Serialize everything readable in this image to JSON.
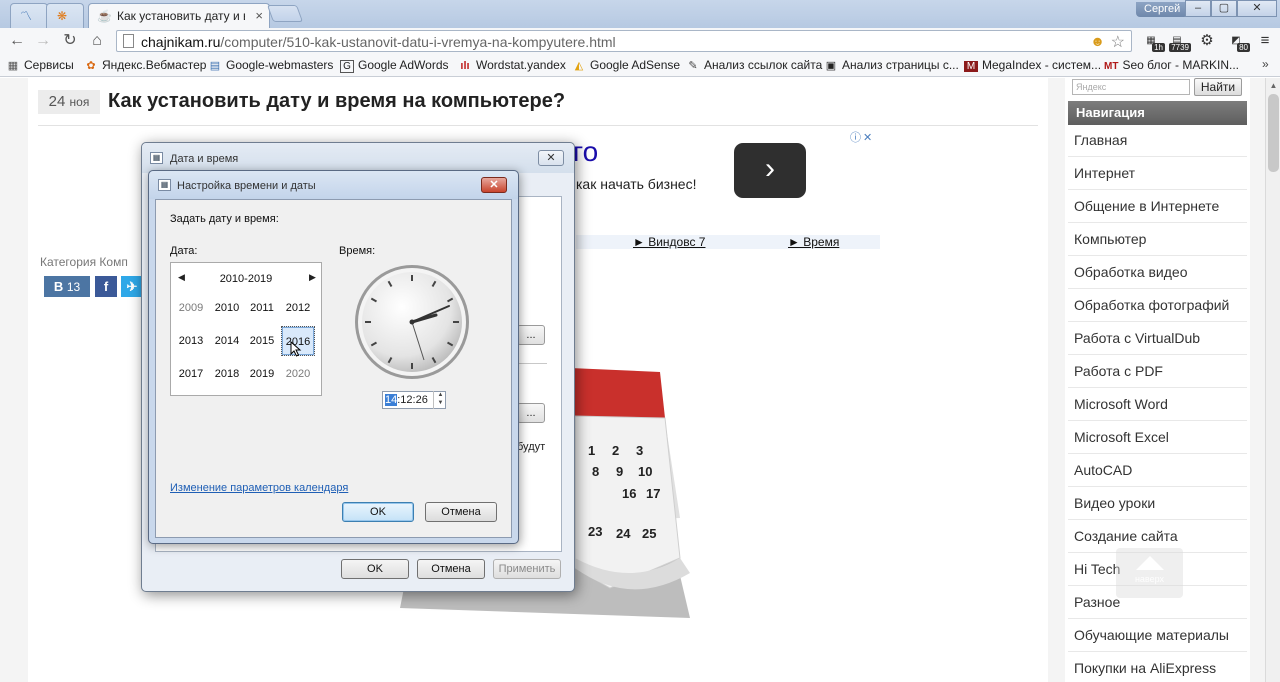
{
  "browser": {
    "tabs": [
      {
        "title": "",
        "icon": "analytics-icon"
      },
      {
        "title": "",
        "icon": "yandex-metrika-icon"
      },
      {
        "title": "Как установить дату и вр",
        "icon": "page-favicon"
      }
    ],
    "user": "Сергей",
    "window_controls": [
      "–",
      "▢",
      "✕"
    ],
    "url_domain": "chajnikam.ru",
    "url_path": "/computer/510-kak-ustanovit-datu-i-vremya-na-kompyutere.html",
    "extensions": [
      {
        "icon": "ext-1h-icon",
        "label": "",
        "badge": "1h"
      },
      {
        "icon": "ext-counter-icon",
        "label": "",
        "badge": "7739"
      },
      {
        "icon": "gear-icon",
        "label": "⚙",
        "badge": ""
      },
      {
        "icon": "ext-80-icon",
        "label": "",
        "badge": "80"
      },
      {
        "icon": "menu-icon",
        "label": "≡",
        "badge": ""
      }
    ],
    "bookmarks": [
      {
        "label": "Сервисы",
        "icon": "apps-grid-icon",
        "glyph": "▦"
      },
      {
        "label": "Яндекс.Вебмастер",
        "icon": "yandex-webmaster-icon",
        "glyph": "✿"
      },
      {
        "label": "Google-webmasters",
        "icon": "google-webmasters-icon",
        "glyph": "▤"
      },
      {
        "label": "Google AdWords",
        "icon": "adwords-icon",
        "glyph": "G"
      },
      {
        "label": "Wordstat.yandex",
        "icon": "wordstat-icon",
        "glyph": "ılı"
      },
      {
        "label": "Google AdSense",
        "icon": "adsense-icon",
        "glyph": "◭"
      },
      {
        "label": "Анализ ссылок сайта",
        "icon": "link-analysis-icon",
        "glyph": "✎"
      },
      {
        "label": "Анализ страницы с...",
        "icon": "page-analysis-icon",
        "glyph": "▣"
      },
      {
        "label": "MegaIndex - систем...",
        "icon": "megaindex-icon",
        "glyph": "M"
      },
      {
        "label": "Seo блог - MARKIN...",
        "icon": "seo-blog-icon",
        "glyph": "MT"
      }
    ],
    "bookmarks_more": "»"
  },
  "article": {
    "date_day": "24",
    "date_month": "ноя",
    "title": "Как установить дату и время на компьютере?",
    "category_label": "Категория Комп",
    "ad_big": "го",
    "ad_sub": "как начать бизнес!",
    "ad_links": [
      "► Виндовс 7",
      "► Время"
    ],
    "share_vk_count": "13"
  },
  "sidebar": {
    "search_placeholder": "Яндекс",
    "search_button": "Найти",
    "nav_title": "Навигация",
    "items": [
      "Главная",
      "Интернет",
      "Общение в Интернете",
      "Компьютер",
      "Обработка видео",
      "Обработка фотографий",
      "Работа с VirtualDub",
      "Работа с PDF",
      "Microsoft Word",
      "Microsoft Excel",
      "AutoCAD",
      "Видео уроки",
      "Создание сайта",
      "Hi Tech",
      "Разное",
      "Обучающие материалы",
      "Покупки на AliExpress"
    ],
    "back_to_top": "наверх"
  },
  "dialog_outer": {
    "title": "Дата и время",
    "ok": "OK",
    "cancel": "Отмена",
    "apply": "Применить",
    "partial_text": "будут"
  },
  "dialog_inner": {
    "title": "Настройка времени и даты",
    "heading": "Задать дату и время:",
    "date_label": "Дата:",
    "time_label": "Время:",
    "calendar_range": "2010-2019",
    "years": [
      "2009",
      "2010",
      "2011",
      "2012",
      "2013",
      "2014",
      "2015",
      "2016",
      "2017",
      "2018",
      "2019",
      "2020"
    ],
    "selected_year": "2016",
    "time_hours": "14",
    "time_rest": ":12:26",
    "calendar_link": "Изменение параметров календаря",
    "ok": "OK",
    "cancel": "Отмена"
  },
  "colors": {
    "tabstrip": "#b6c9e2",
    "nav_header": "#6b6b6b",
    "link": "#1f5fb5",
    "calendar_red": "#c9302c"
  }
}
